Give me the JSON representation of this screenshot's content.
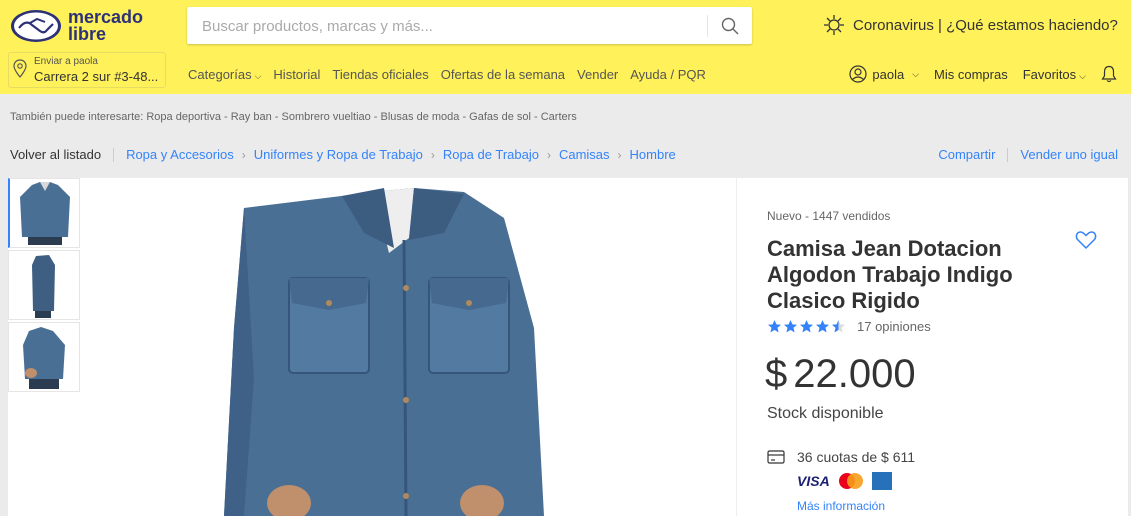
{
  "header": {
    "logo_text_1": "mercado",
    "logo_text_2": "libre",
    "search_placeholder": "Buscar productos, marcas y más...",
    "promo": "Coronavirus | ¿Qué estamos haciendo?",
    "location_label": "Enviar a paola",
    "location_value": "Carrera 2 sur #3-48...",
    "nav": [
      "Categorías",
      "Historial",
      "Tiendas oficiales",
      "Ofertas de la semana",
      "Vender",
      "Ayuda / PQR"
    ],
    "user": "paola",
    "my_purchases": "Mis compras",
    "favorites": "Favoritos"
  },
  "related": "También puede interesarte: Ropa deportiva - Ray ban - Sombrero vueltiao - Blusas de moda - Gafas de sol - Carters",
  "breadcrumb": {
    "back": "Volver al listado",
    "items": [
      "Ropa y Accesorios",
      "Uniformes y Ropa de Trabajo",
      "Ropa de Trabajo",
      "Camisas",
      "Hombre"
    ],
    "share": "Compartir",
    "sell_same": "Vender uno igual"
  },
  "product": {
    "condition": "Nuevo  -  1447 vendidos",
    "title": "Camisa Jean Dotacion Algodon Trabajo Indigo Clasico Rigido",
    "rating": 4.5,
    "opinions": "17 opiniones",
    "price_symbol": "$",
    "price": "22.000",
    "stock": "Stock disponible",
    "installments": "36 cuotas de $ 611",
    "cards": [
      "VISA",
      "Mastercard",
      "American Express"
    ],
    "more_info": "Más información"
  },
  "colors": {
    "header_bg": "#fff159",
    "link": "#3483fa",
    "denim": "#4a6f95"
  }
}
